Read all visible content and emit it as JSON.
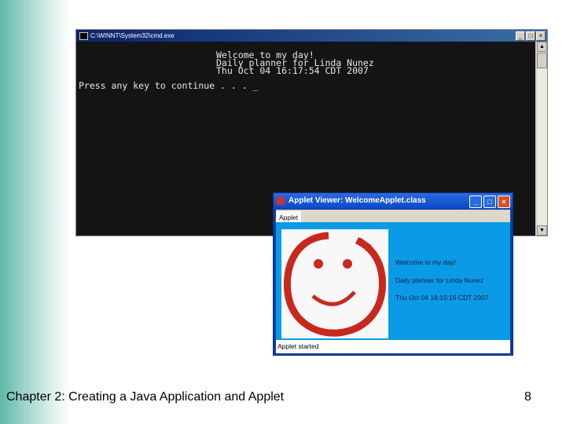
{
  "cmd_window": {
    "title": "C:\\WINNT\\System32\\cmd.exe",
    "buttons": [
      "_",
      "□",
      "×"
    ],
    "lines": [
      "Welcome to my day!",
      "Daily planner for Linda Nunez",
      "Thu Oct 04 16:17:54 CDT 2007",
      "Press any key to continue . . . _"
    ]
  },
  "applet_window": {
    "title": "Applet Viewer: WelcomeApplet.class",
    "buttons": [
      "_",
      "□",
      "×"
    ],
    "menu": "Applet",
    "messages": [
      "Welcome to my day!",
      "Daily planner for Linda Nunez",
      "Thu Oct 04 16:15:16 CDT 2007"
    ],
    "status": "Applet started",
    "colors": {
      "content": "#0a9ae6",
      "smiley": "#c8281e"
    }
  },
  "footer": {
    "caption": "Chapter 2: Creating a Java Application and Applet",
    "page": "8"
  }
}
